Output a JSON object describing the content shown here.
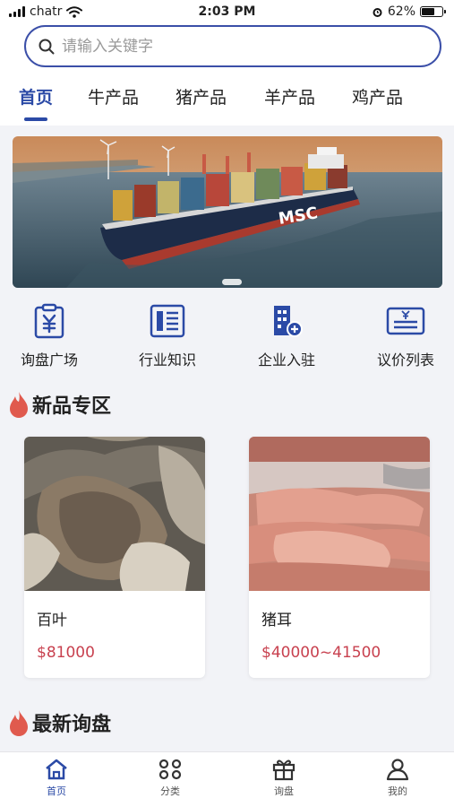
{
  "status_bar": {
    "carrier": "chatr",
    "time": "2:03 PM",
    "battery": "62%",
    "battery_level": 0.62
  },
  "search": {
    "placeholder": "请输入关键字"
  },
  "category_tabs": [
    {
      "label": "首页",
      "active": true
    },
    {
      "label": "牛产品",
      "active": false
    },
    {
      "label": "猪产品",
      "active": false
    },
    {
      "label": "羊产品",
      "active": false
    },
    {
      "label": "鸡产品",
      "active": false
    }
  ],
  "banner": {
    "ship_text": "MSC"
  },
  "quick_links": [
    {
      "label": "询盘广场",
      "icon": "clipboard-yuan-icon"
    },
    {
      "label": "行业知识",
      "icon": "document-list-icon"
    },
    {
      "label": "企业入驻",
      "icon": "building-add-icon"
    },
    {
      "label": "议价列表",
      "icon": "price-list-icon"
    }
  ],
  "new_products": {
    "title": "新品专区",
    "items": [
      {
        "name": "百叶",
        "price": "$81000"
      },
      {
        "name": "猪耳",
        "price": "$40000~41500"
      }
    ]
  },
  "latest_inquiries": {
    "title": "最新询盘"
  },
  "bottom_nav": [
    {
      "label": "首页",
      "icon": "home-icon",
      "active": true
    },
    {
      "label": "分类",
      "icon": "grid-circles-icon",
      "active": false
    },
    {
      "label": "询盘",
      "icon": "gift-box-icon",
      "active": false
    },
    {
      "label": "我的",
      "icon": "user-icon",
      "active": false
    }
  ],
  "colors": {
    "accent": "#2b4aa6",
    "price": "#c8414f",
    "flame": "#e05a4e",
    "background": "#f2f3f7"
  }
}
